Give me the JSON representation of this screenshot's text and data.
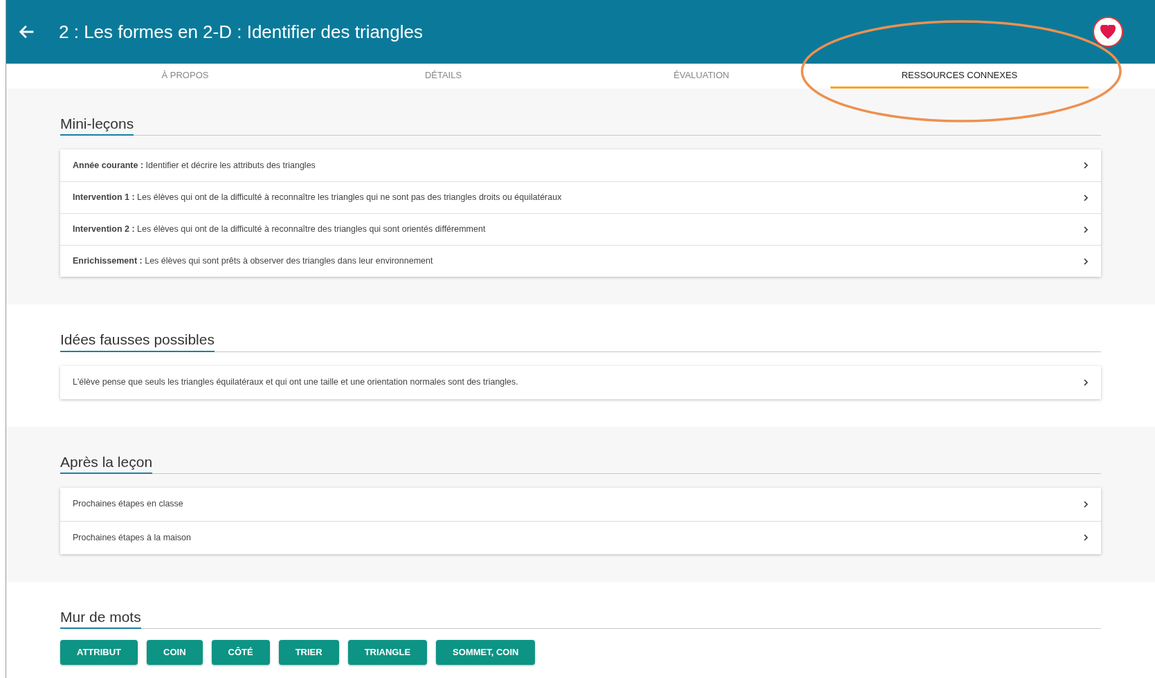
{
  "header": {
    "title": "2 : Les formes en 2-D : Identifier des triangles",
    "favorite": true
  },
  "tabs": [
    {
      "label": "À PROPOS",
      "selected": false,
      "circled": false
    },
    {
      "label": "DÉTAILS",
      "selected": false,
      "circled": false
    },
    {
      "label": "ÉVALUATION",
      "selected": false,
      "circled": false
    },
    {
      "label": "RESSOURCES CONNEXES",
      "selected": true,
      "circled": true
    }
  ],
  "sections": [
    {
      "title": "Mini-leçons",
      "items": [
        "**Année courante :** Identifier et décrire les attributs des triangles",
        "**Intervention 1 :** Les élèves qui ont de la difficulté à reconnaître les triangles qui ne sont pas des triangles droits ou équilatéraux",
        "**Intervention 2 :** Les élèves qui ont de la difficulté à reconnaître des triangles qui sont orientés différemment",
        "**Enrichissement :** Les élèves qui sont prêts à observer des triangles dans leur environnement"
      ]
    },
    {
      "title": "Idées fausses possibles",
      "items": [
        "L'élève pense que seuls les triangles équilatéraux et qui ont une taille et une orientation normales sont des triangles."
      ]
    },
    {
      "title": "Après la leçon",
      "items": [
        "Prochaines étapes en classe",
        "Prochaines étapes à la maison"
      ]
    }
  ],
  "word_wall": {
    "title": "Mur de mots",
    "words": [
      "ATTRIBUT",
      "COIN",
      "CÔTÉ",
      "TRIER",
      "TRIANGLE",
      "SOMMET, COIN"
    ]
  }
}
